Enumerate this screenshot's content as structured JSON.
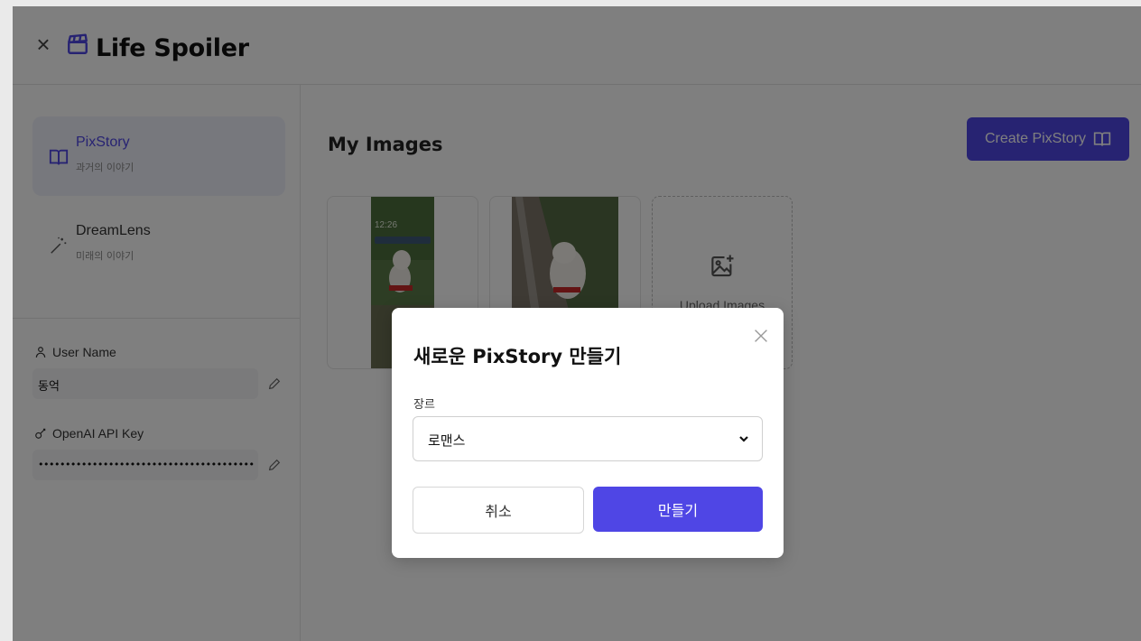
{
  "app": {
    "title": "Life Spoiler"
  },
  "sidebar": {
    "items": [
      {
        "label": "PixStory",
        "sublabel": "과거의 이야기",
        "icon": "book-open-icon",
        "active": true
      },
      {
        "label": "DreamLens",
        "sublabel": "미래의 이야기",
        "icon": "magic-wand-icon",
        "active": false
      }
    ],
    "user_name": {
      "label": "User Name",
      "value": "동억",
      "icon": "user-icon"
    },
    "api_key": {
      "label": "OpenAI API Key",
      "value": "••••••••••••••••••••••••••••••••••••••••",
      "icon": "key-icon"
    }
  },
  "main": {
    "title": "My Images",
    "create_button": "Create PixStory",
    "upload_label": "Upload Images",
    "photo_timestamp": "12:26"
  },
  "modal": {
    "title": "새로운 PixStory 만들기",
    "genre_label": "장르",
    "genre_value": "로맨스",
    "cancel_label": "취소",
    "create_label": "만들기"
  },
  "colors": {
    "accent": "#4f46e5",
    "overlay": "rgba(0,0,0,0.5)"
  }
}
